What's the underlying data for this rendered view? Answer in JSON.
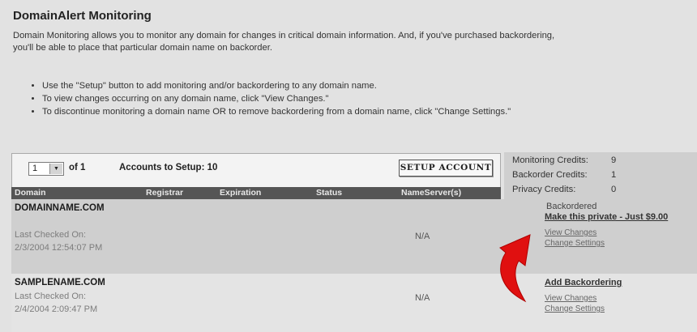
{
  "page": {
    "title": "DomainAlert Monitoring",
    "intro": "Domain Monitoring allows you to monitor any domain for changes in critical domain information. And, if you've purchased backordering, you'll be able to place that particular domain name on backorder.",
    "bullets": [
      "Use the \"Setup\" button to add monitoring and/or backordering to any domain name.",
      "To view changes occurring on any domain name, click \"View Changes.\"",
      "To discontinue monitoring a domain name OR to remove backordering from a domain name, click \"Change Settings.\""
    ]
  },
  "pager": {
    "selected_page": "1",
    "of_label": "of 1",
    "accounts_to_setup": "Accounts to Setup: 10"
  },
  "toolbar": {
    "setup_label": "SETUP ACCOUNT"
  },
  "table": {
    "columns": [
      "Domain",
      "Registrar",
      "Expiration",
      "Status",
      "NameServer(s)"
    ],
    "rows": [
      {
        "domain": "DOMAINNAME.COM",
        "last_checked_label": "Last Checked On:",
        "last_checked": "2/3/2004 12:54:07 PM",
        "nameservers": "N/A",
        "status_text": "Backordered",
        "private_link": "Make this private - Just $9.00",
        "view_changes": "View Changes",
        "change_settings": "Change Settings"
      },
      {
        "domain": "SAMPLENAME.COM",
        "last_checked_label": "Last Checked On:",
        "last_checked": "2/4/2004 2:09:47 PM",
        "nameservers": "N/A",
        "add_backordering": "Add Backordering",
        "view_changes": "View Changes",
        "change_settings": "Change Settings"
      }
    ]
  },
  "credits": {
    "monitoring_label": "Monitoring Credits:",
    "monitoring_value": "9",
    "backorder_label": "Backorder Credits:",
    "backorder_value": "1",
    "privacy_label": "Privacy Credits:",
    "privacy_value": "0"
  },
  "colors": {
    "header_bg": "#555555",
    "row_alt_bg": "#cfcfcf",
    "arrow": "#e01010"
  },
  "icons": {
    "dropdown": "chevron-down-icon",
    "annotation": "curved-red-arrow"
  }
}
